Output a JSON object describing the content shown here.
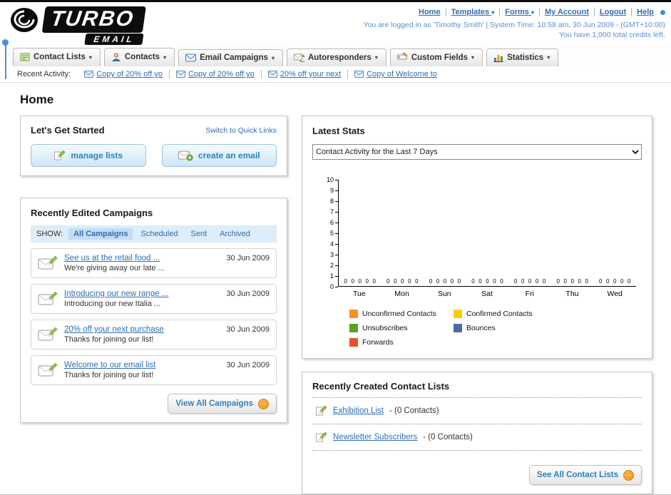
{
  "ui": {
    "dropdown_arrow": "▾",
    "arrow_right": "→"
  },
  "header": {
    "logo_title": "TURBO",
    "logo_subtitle": "EMAIL",
    "nav_links": [
      {
        "label": "Home",
        "dropdown": false
      },
      {
        "label": "Templates",
        "dropdown": true
      },
      {
        "label": "Forms",
        "dropdown": true
      },
      {
        "label": "My Account",
        "dropdown": false
      },
      {
        "label": "Logout",
        "dropdown": false
      },
      {
        "label": "Help",
        "dropdown": false
      }
    ],
    "login_info": "You are logged in as 'Timothy Smith' | System Time: 10:58 am, 30 Jun 2009 - (GMT+10:00)",
    "credits": "You have 1,000 total credits left."
  },
  "main_nav": {
    "tabs": [
      {
        "label": "Contact Lists"
      },
      {
        "label": "Contacts"
      },
      {
        "label": "Email Campaigns"
      },
      {
        "label": "Autoresponders"
      },
      {
        "label": "Custom Fields"
      },
      {
        "label": "Statistics"
      }
    ]
  },
  "recent_activity": {
    "label": "Recent Activity:",
    "items": [
      "Copy of 20% off yo",
      "Copy of 20% off yo",
      "20% off your next",
      "Copy of Welcome to"
    ]
  },
  "page_title": "Home",
  "get_started": {
    "title": "Let's Get Started",
    "switch_link": "Switch to Quick Links",
    "buttons": [
      {
        "label": "manage lists"
      },
      {
        "label": "create an email"
      }
    ]
  },
  "campaigns": {
    "title": "Recently Edited Campaigns",
    "show_label": "SHOW:",
    "filters": [
      "All Campaigns",
      "Scheduled",
      "Sent",
      "Archived"
    ],
    "active_filter": "All Campaigns",
    "items": [
      {
        "title": "See us at the retail food ...",
        "subtitle": "We're giving away our late ...",
        "date": "30 Jun 2009"
      },
      {
        "title": "Introducing our new range ...",
        "subtitle": "Introducing our new Italia ...",
        "date": "30 Jun 2009"
      },
      {
        "title": "20% off your next purchase",
        "subtitle": "Thanks for joining our list!",
        "date": "30 Jun 2009"
      },
      {
        "title": "Welcome to our email list",
        "subtitle": "Thanks for joining our list!",
        "date": "30 Jun 2009"
      }
    ],
    "view_all_label": "View All Campaigns"
  },
  "latest_stats": {
    "title": "Latest Stats",
    "dropdown_value": "Contact Activity for the Last 7 Days",
    "chart_data": {
      "type": "bar",
      "title": "Contact Activity for the Last 7 Days",
      "categories": [
        "Tue",
        "Mon",
        "Sun",
        "Sat",
        "Fri",
        "Thu",
        "Wed"
      ],
      "series": [
        {
          "name": "Unconfirmed Contacts",
          "color": "#f7941d",
          "values": [
            0,
            0,
            0,
            0,
            0,
            0,
            0
          ]
        },
        {
          "name": "Confirmed Contacts",
          "color": "#ffcc00",
          "values": [
            0,
            0,
            0,
            0,
            0,
            0,
            0
          ]
        },
        {
          "name": "Unsubscribes",
          "color": "#5aa321",
          "values": [
            0,
            0,
            0,
            0,
            0,
            0,
            0
          ]
        },
        {
          "name": "Bounces",
          "color": "#4a6f9f",
          "values": [
            0,
            0,
            0,
            0,
            0,
            0,
            0
          ]
        },
        {
          "name": "Forwards",
          "color": "#e8542a",
          "values": [
            0,
            0,
            0,
            0,
            0,
            0,
            0
          ]
        }
      ],
      "ylim": [
        0,
        10
      ],
      "ytick_step": 1,
      "grid": false,
      "legend_position": "bottom"
    }
  },
  "contact_lists": {
    "title": "Recently Created Contact Lists",
    "items": [
      {
        "name": "Exhibition List",
        "detail": "- (0 Contacts)"
      },
      {
        "name": "Newsletter Subscribers",
        "detail": "- (0 Contacts)"
      }
    ],
    "see_all_label": "See All Contact Lists"
  }
}
